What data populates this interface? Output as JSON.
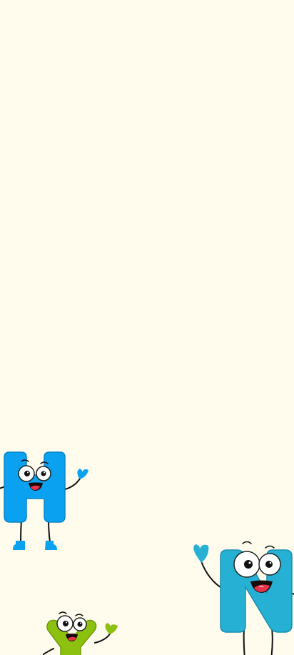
{
  "screen": {
    "background_color": "#FFFCEE"
  },
  "mascots": [
    {
      "id": "letter-h",
      "letter": "H",
      "body_color": "#0AA2F0",
      "outline_color": "#0786C8"
    },
    {
      "id": "letter-n",
      "letter": "N",
      "body_color": "#26B0D4",
      "outline_color": "#1A8FAF"
    },
    {
      "id": "letter-y",
      "letter": "Y",
      "body_color": "#8DC10F",
      "outline_color": "#6D9A06"
    }
  ],
  "colors": {
    "eye_white": "#FFFFFF",
    "eye_ring": "#222222",
    "pupil": "#111111",
    "mouth": "#1A0A0A",
    "tongue": "#E8344B",
    "limb": "#111111"
  }
}
